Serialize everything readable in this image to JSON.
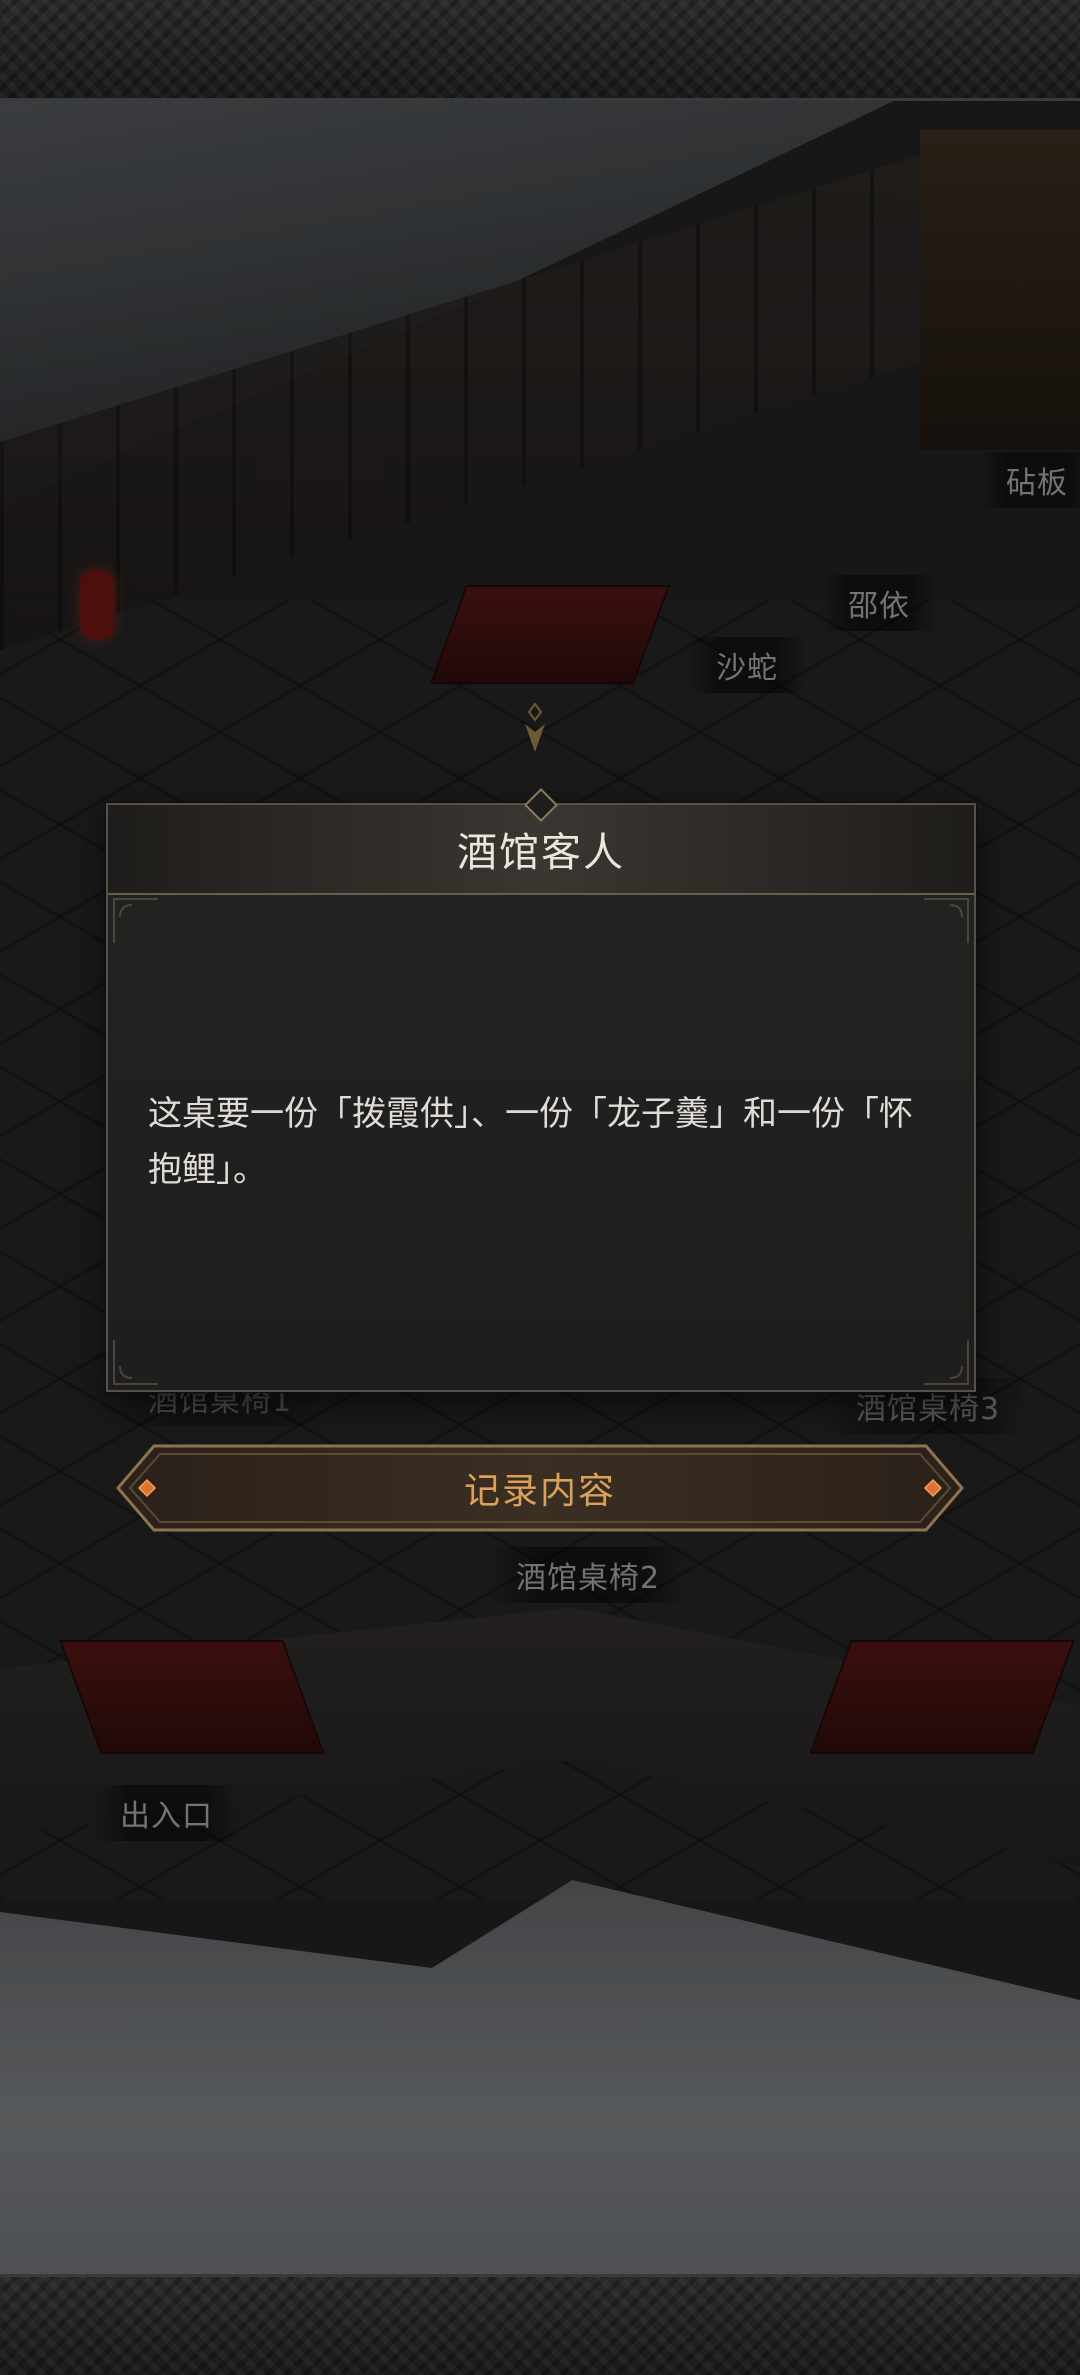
{
  "scene": {
    "labels": {
      "anban": "砧板",
      "shaoyi": "邵依",
      "shashe": "沙蛇",
      "table1": "酒馆桌椅1",
      "table2": "酒馆桌椅2",
      "table3": "酒馆桌椅3",
      "exit": "出入口"
    }
  },
  "dialog": {
    "title": "酒馆客人",
    "text": "这桌要一份「拨霞供」、一份「龙子羹」和一份「怀抱鲤」。"
  },
  "record_button": {
    "label": "记录内容"
  },
  "colors": {
    "accent_gold": "#d9a15a",
    "dialog_border": "#5a5146",
    "text_light": "#e0dcd5"
  }
}
